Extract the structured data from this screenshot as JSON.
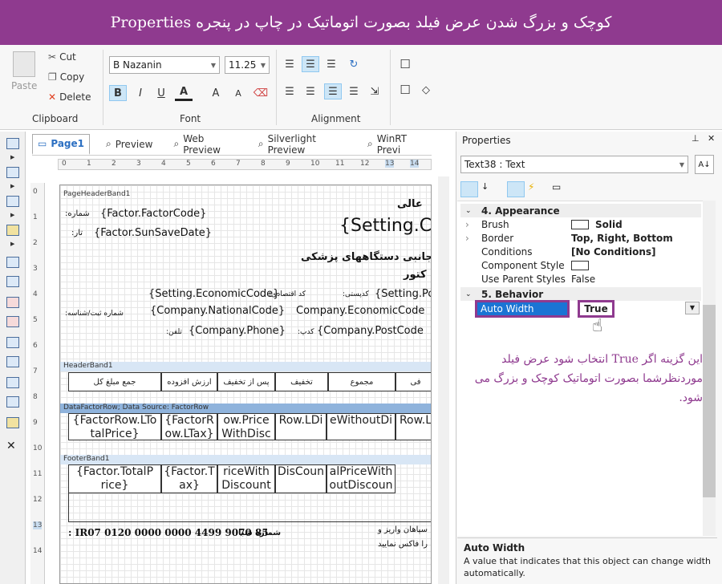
{
  "banner": {
    "title": "کوچک و بزرگ شدن عرض فیلد بصورت اتوماتیک در چاپ در پنجره Properties"
  },
  "ribbon": {
    "clipboard": {
      "paste": "Paste",
      "cut": "Cut",
      "copy": "Copy",
      "delete": "Delete",
      "label": "Clipboard"
    },
    "font": {
      "family": "B Nazanin",
      "size": "11.25",
      "label": "Font",
      "bold": "B",
      "italic": "I",
      "underline": "U",
      "color": "A",
      "grow": "A",
      "shrink": "A"
    },
    "alignment": {
      "label": "Alignment"
    }
  },
  "designer": {
    "tabs": [
      "Page1",
      "Preview",
      "Web Preview",
      "Silverlight Preview",
      "WinRT Previ"
    ],
    "ruler_ticks": [
      "0",
      "1",
      "2",
      "3",
      "4",
      "5",
      "6",
      "7",
      "8",
      "9",
      "10",
      "11",
      "12",
      "13",
      "14"
    ],
    "vruler_ticks": [
      "0",
      "1",
      "2",
      "3",
      "4",
      "5",
      "6",
      "7",
      "8",
      "9",
      "10",
      "11",
      "12",
      "13",
      "14"
    ],
    "bands": {
      "page_header": "PageHeaderBand1",
      "header": "HeaderBand1",
      "data": "DataFactorRow; Data Source: FactorRow",
      "footer": "FooterBand1"
    },
    "fields": {
      "factor_code": "{Factor.FactorCode}",
      "factor_code_label": ":شماره",
      "save_date": "{Factor.SunSaveDate}",
      "save_date_label": ":تار",
      "setting_co": "{Setting.Co",
      "title_part": "عالی",
      "subtitle": "م جانبی دستگاههای پزشکی",
      "subtitle2": "کتور",
      "economic_code": "{Setting.EconomicCode}",
      "economic_label": ":کد اقتصادی",
      "postal_label": ":کدپستی",
      "setting_po": "{Setting.Po",
      "national_code": "{Company.NationalCode}",
      "national_label": ":شماره ثبت/شناسه",
      "company_economic": "Company.EconomicCode",
      "phone": "{Company.Phone}",
      "phone_label": ":تلفن",
      "post_code": "{Company.PostCode",
      "post_label": ":کدپ",
      "account": ": IR07 0120 0000 0000 4499 9070 85",
      "account_label": "شماره شبا",
      "footer_note1": "سپاهان واریز و",
      "footer_note2": "را فاکس نمایید"
    },
    "header_cells": [
      "جمع مبلغ کل",
      "ارزش افزوده",
      "پس از تخفیف",
      "تخفیف",
      "مجموع",
      "فی"
    ],
    "data_cells": [
      "{FactorRow.LTo talPrice}",
      "{FactorR ow.LTax}",
      "ow.Price WithDisc",
      "Row.LDi",
      "eWithoutDi",
      "Row.L"
    ],
    "footer_cells": [
      "{Factor.TotalP rice}",
      "{Factor.T ax}",
      "riceWith Discount",
      "DisCoun",
      "alPriceWith outDiscoun"
    ]
  },
  "properties": {
    "title": "Properties",
    "object": "Text38 : Text",
    "categories": {
      "appearance": "4. Appearance",
      "behavior": "5. Behavior"
    },
    "rows": [
      {
        "name": "Brush",
        "value": "Solid"
      },
      {
        "name": "Border",
        "value": "Top, Right, Bottom"
      },
      {
        "name": "Conditions",
        "value": "[No Conditions]"
      },
      {
        "name": "Component Style",
        "value": ""
      },
      {
        "name": "Use Parent Styles",
        "value": "False"
      }
    ],
    "auto_width": {
      "name": "Auto Width",
      "value": "True"
    },
    "annotation": "این گزینه اگر  True  انتخاب شود عرض فیلد موردنظرشما بصورت اتوماتیک کوچک و بزرگ می شود.",
    "help_title": "Auto Width",
    "help_text": "A value that indicates that this object can change width automatically.",
    "accent": "#8f3a8f",
    "selection": "#1a74d4"
  }
}
